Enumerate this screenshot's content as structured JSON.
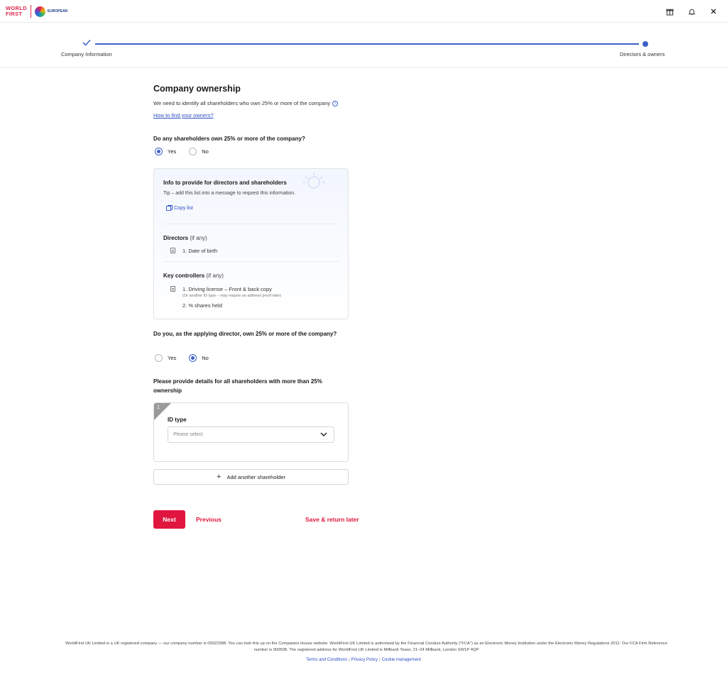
{
  "header": {
    "logo_line1": "WORLD",
    "logo_line2": "FIRST",
    "partner_logo_text": "EUROPEAN"
  },
  "stepper": {
    "steps": [
      {
        "label": "Company Information",
        "state": "completed"
      },
      {
        "label": "Directors & owners",
        "state": "current"
      }
    ]
  },
  "page": {
    "title": "Company ownership",
    "subtitle": "We need to identify all shareholders who own 25% or more of the company",
    "help_link": "How to find your owners?"
  },
  "q1": {
    "question": "Do any shareholders own 25% or more of the company?",
    "options": [
      "Yes",
      "No"
    ],
    "selected": "Yes"
  },
  "info_card": {
    "title": "Info to provide for directors and shareholders",
    "tip": "Tip – add this list into a message to request this information.",
    "copy_label": "Copy list",
    "directors_title": "Directors",
    "directors_hint": "(if any)",
    "directors_items": [
      "1. Date of birth"
    ],
    "controllers_title": "Key controllers",
    "controllers_hint": "(if any)",
    "controllers_item1": "1. Driving license – Front & back copy",
    "controllers_item1_note": "(Or another ID type – may require an address proof later)",
    "controllers_item2": "2. % shares held"
  },
  "q2": {
    "question": "Do you, as the applying director, own 25% or more of the company?",
    "options": [
      "Yes",
      "No"
    ],
    "selected": "No"
  },
  "q3": {
    "question": "Please provide details for all shareholders with more than 25% ownership"
  },
  "shareholder": {
    "index": "1",
    "id_type_label": "ID type",
    "id_type_placeholder": "Please select"
  },
  "actions": {
    "add_shareholder": "Add another shareholder",
    "next": "Next",
    "previous": "Previous",
    "save_later": "Save & return later"
  },
  "footer": {
    "legal": "WorldFirst UK Limited is a UK registered company — our company number is 05022388. You can look this up on the Companies House website. WorldFirst UK Limited is authorised by the Financial Conduct Authority (\"FCA\") as an Electronic Money Institution under the Electronic Money Regulations 2011: Our FCA Firm Reference number is 900508. The registered address for WorldFirst UK Limited is Millbank Tower, 21–24 Millbank, London SW1P 4QP",
    "links": [
      "Terms and Conditions",
      "Privacy Policy",
      "Cookie management"
    ]
  },
  "colors": {
    "brand_red": "#e0163f",
    "accent_blue": "#3c5fc8",
    "link_blue": "#2b4fc6"
  },
  "icons": {
    "top_right": [
      "gift-icon",
      "bell-icon",
      "close-icon"
    ]
  }
}
